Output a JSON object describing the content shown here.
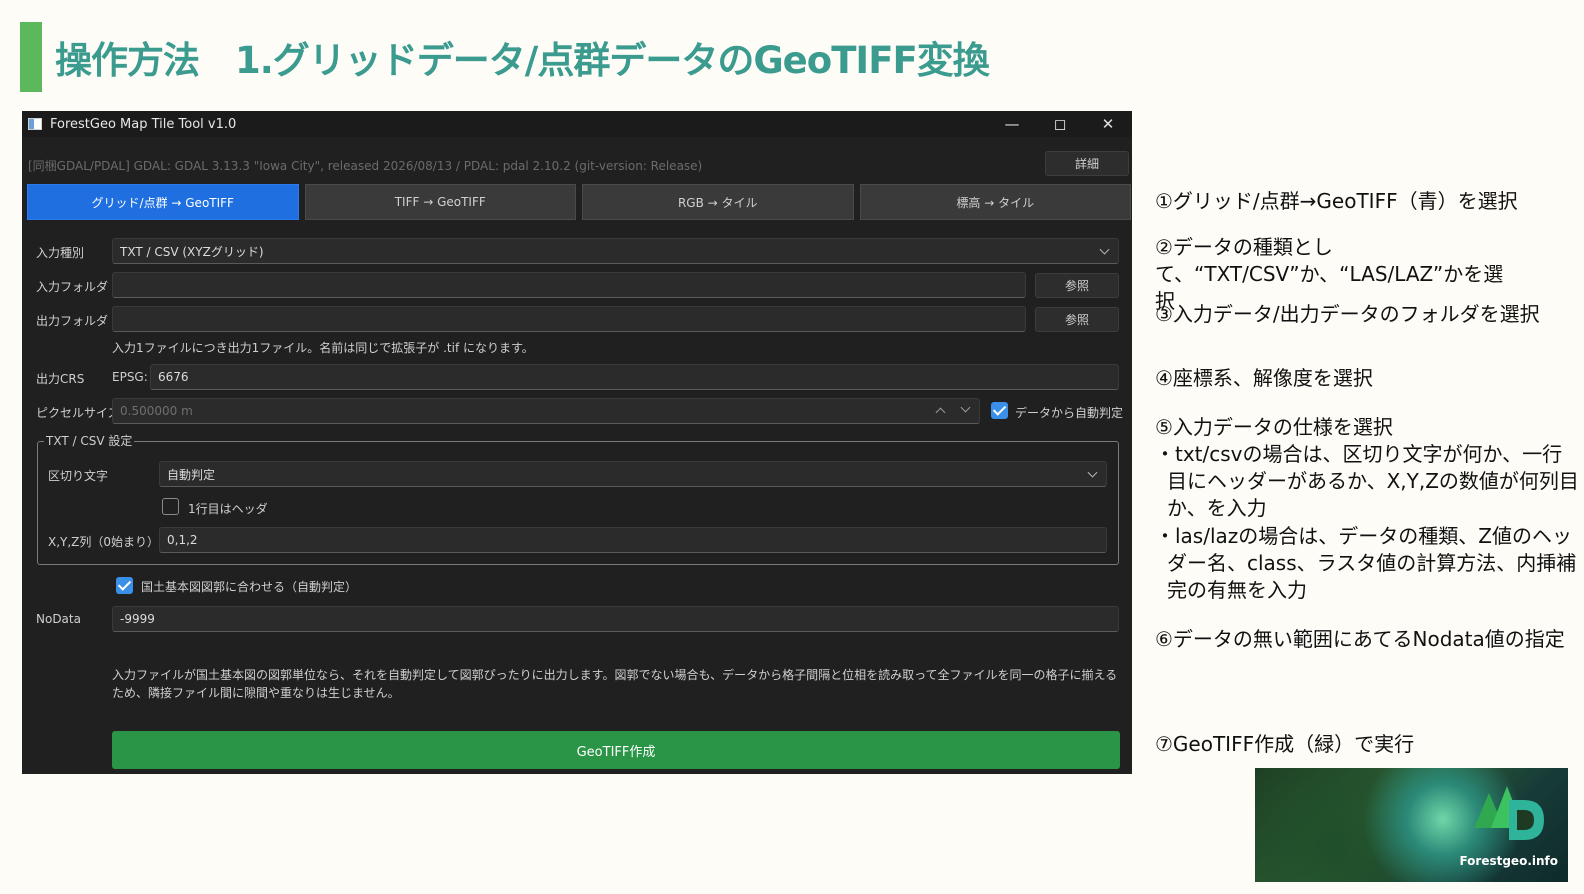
{
  "slide": {
    "title": "操作方法　1.グリッドデータ/点群データのGeoTIFF変換"
  },
  "app": {
    "window_title": "ForestGeo Map Tile Tool v1.0",
    "version_text": "[同梱GDAL/PDAL]  GDAL: GDAL 3.13.3 \"Iowa City\", released 2026/08/13  /  PDAL: pdal 2.10.2 (git-version: Release)",
    "detail_button": "詳細",
    "tabs": [
      {
        "label": "グリッド/点群 → GeoTIFF",
        "active": true
      },
      {
        "label": "TIFF → GeoTIFF",
        "active": false
      },
      {
        "label": "RGB → タイル",
        "active": false
      },
      {
        "label": "標高 → タイル",
        "active": false
      }
    ],
    "input_type": {
      "label": "入力種別",
      "value": "TXT / CSV (XYZグリッド)"
    },
    "input_folder": {
      "label": "入力フォルダ",
      "value": "",
      "button": "参照"
    },
    "output_folder": {
      "label": "出力フォルダ",
      "value": "",
      "button": "参照"
    },
    "output_note": "入力1ファイルにつき出力1ファイル。名前は同じで拡張子が .tif になります。",
    "output_crs": {
      "label": "出力CRS",
      "prefix": "EPSG:",
      "value": "6676"
    },
    "pixel_size": {
      "label": "ピクセルサイズ",
      "value": "0.500000 m",
      "auto_label": "データから自動判定",
      "auto_checked": true
    },
    "txt_csv_group": {
      "title": "TXT / CSV 設定",
      "delimiter_label": "区切り文字",
      "delimiter_value": "自動判定",
      "header_label": "1行目はヘッダ",
      "header_checked": false,
      "xyz_label": "X,Y,Z列（0始まり）",
      "xyz_value": "0,1,2"
    },
    "align_sheet": {
      "label": "国土基本図図郭に合わせる（自動判定）",
      "checked": true
    },
    "nodata": {
      "label": "NoData",
      "value": "-9999"
    },
    "footer_note": "入力ファイルが国土基本図の図郭単位なら、それを自動判定して図郭ぴったりに出力します。図郭でない場合も、データから格子間隔と位相を読み取って全ファイルを同一の格子に揃えるため、隣接ファイル間に隙間や重なりは生じません。",
    "run_button": "GeoTIFF作成",
    "colors": {
      "active_tab": "#1f6fe0",
      "run_button": "#2a9447",
      "checkbox": "#3a8fe8"
    }
  },
  "steps": [
    "①グリッド/点群→GeoTIFF（青）を選択",
    "②データの種類として、“TXT/CSV”か、“LAS/LAZ”かを選択",
    "③入力データ/出力データのフォルダを選択",
    "④座標系、解像度を選択",
    "⑤入力データの仕様を選択",
    "・txt/csvの場合は、区切り文字が何か、一行目にヘッダーがあるか、X,Y,Zの数値が何列目か、を入力",
    "・las/lazの場合は、データの種類、Z値のヘッダー名、class、ラスタ値の計算方法、内挿補完の有無を入力",
    "⑥データの無い範囲にあてるNodata値の指定",
    "⑦GeoTIFF作成（緑）で実行"
  ],
  "logo": {
    "text": "Forestgeo.info"
  }
}
